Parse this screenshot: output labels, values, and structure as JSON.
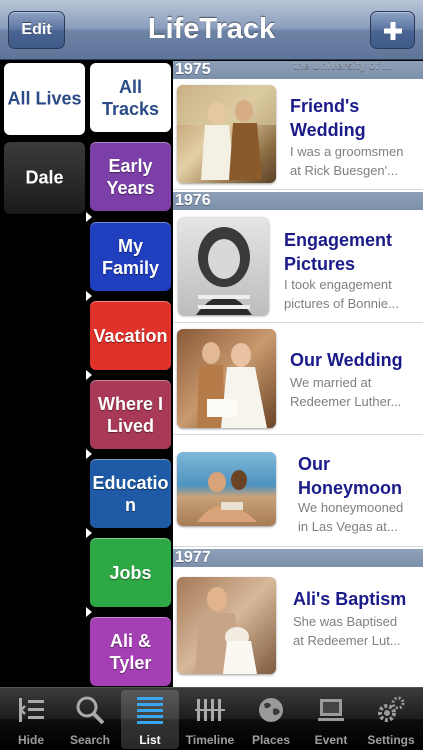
{
  "app": {
    "title": "LifeTrack"
  },
  "navbar": {
    "edit_label": "Edit",
    "add_icon": "plus-icon"
  },
  "lives": [
    {
      "label": "All Lives",
      "selected": true
    },
    {
      "label": "Dale",
      "selected": false
    }
  ],
  "tracks": [
    {
      "line1": "All",
      "line2": "Tracks",
      "color": "#ffffff",
      "selected": true
    },
    {
      "line1": "Early",
      "line2": "Years",
      "color": "#7b3fa7"
    },
    {
      "line1": "My",
      "line2": "Family",
      "color": "#1f3fbf"
    },
    {
      "line1": "Vacation",
      "line2": "",
      "color": "#e0322b"
    },
    {
      "line1": "Where I",
      "line2": "Lived",
      "color": "#a83a58"
    },
    {
      "line1": "Educatio",
      "line2": "n",
      "color": "#1e5aa5"
    },
    {
      "line1": "Jobs",
      "line2": "",
      "color": "#2ea845"
    },
    {
      "line1": "Ali &",
      "line2": "Tyler",
      "color": "#a43fb4"
    }
  ],
  "faded_header_text": "the University of ...",
  "sections": [
    {
      "year": "1975",
      "events": [
        {
          "title1": "Friend's",
          "title2": "Wedding",
          "desc1": "I was a groomsmen",
          "desc2": "at Rick Buesgen'..."
        }
      ]
    },
    {
      "year": "1976",
      "events": [
        {
          "title1": "Engagement",
          "title2": "Pictures",
          "desc1": "I took engagement",
          "desc2": "pictures of Bonnie..."
        },
        {
          "title1": "Our Wedding",
          "title2": "",
          "desc1": "We married at",
          "desc2": "Redeemer Luther..."
        },
        {
          "title1": "Our",
          "title2": "Honeymoon",
          "desc1": "We honeymooned",
          "desc2": "in Las Vegas at..."
        }
      ]
    },
    {
      "year": "1977",
      "events": [
        {
          "title1": "Ali's Baptism",
          "title2": "",
          "desc1": "She was Baptised",
          "desc2": "at Redeemer Lut..."
        }
      ]
    }
  ],
  "tabbar": [
    {
      "label": "Hide",
      "icon": "hide-icon",
      "active": false
    },
    {
      "label": "Search",
      "icon": "search-icon",
      "active": false
    },
    {
      "label": "List",
      "icon": "list-icon",
      "active": true
    },
    {
      "label": "Timeline",
      "icon": "timeline-icon",
      "active": false
    },
    {
      "label": "Places",
      "icon": "globe-icon",
      "active": false
    },
    {
      "label": "Event",
      "icon": "event-icon",
      "active": false
    },
    {
      "label": "Settings",
      "icon": "gear-icon",
      "active": false
    }
  ]
}
